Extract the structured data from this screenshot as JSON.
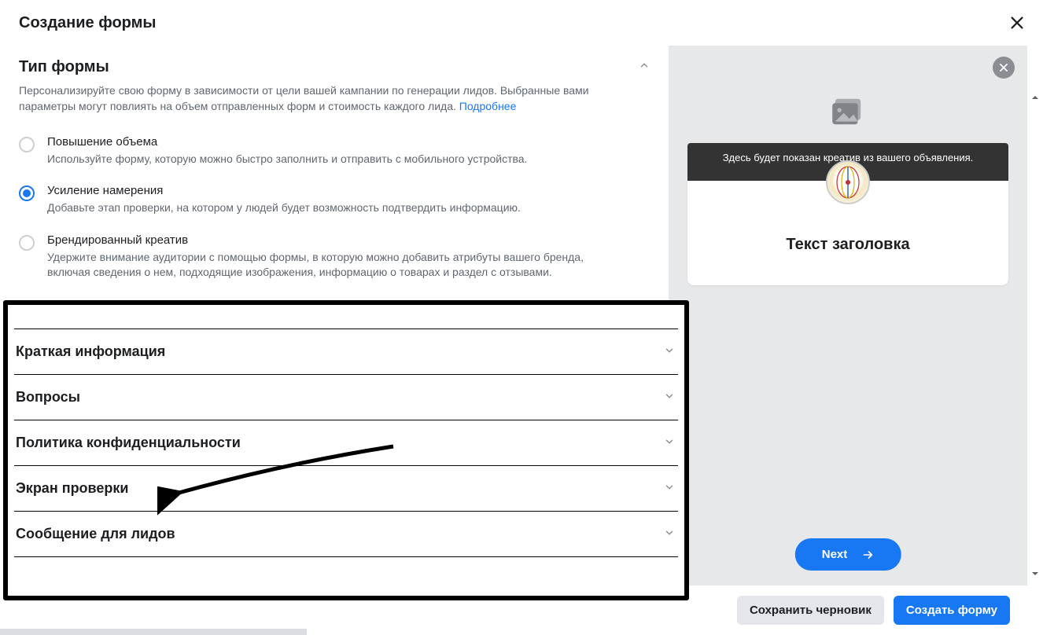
{
  "header": {
    "title": "Создание формы"
  },
  "formType": {
    "title": "Тип формы",
    "description_before_link": "Персонализируйте свою форму в зависимости от цели вашей кампании по генерации лидов. Выбранные вами параметры могут повлиять на объем отправленных форм и стоимость каждого лида. ",
    "link_text": "Подробнее",
    "options": [
      {
        "title": "Повышение объема",
        "description": "Используйте форму, которую можно быстро заполнить и отправить с мобильного устройства.",
        "selected": false
      },
      {
        "title": "Усиление намерения",
        "description": "Добавьте этап проверки, на котором у людей будет возможность подтвердить информацию.",
        "selected": true
      },
      {
        "title": "Брендированный креатив",
        "description": "Удержите внимание аудитории с помощью формы, в которую можно добавить атрибуты вашего бренда, включая сведения о нем, подходящие изображения, информацию о товарах и раздел с отзывами.",
        "selected": false
      }
    ]
  },
  "sections": [
    {
      "title": "Краткая информация"
    },
    {
      "title": "Вопросы"
    },
    {
      "title": "Политика конфиденциальности"
    },
    {
      "title": "Экран проверки"
    },
    {
      "title": "Сообщение для лидов"
    }
  ],
  "preview": {
    "creative_caption": "Здесь будет показан креатив из вашего объявления.",
    "headline": "Текст заголовка",
    "next_label": "Next"
  },
  "footer": {
    "save_draft": "Сохранить черновик",
    "create": "Создать форму"
  }
}
